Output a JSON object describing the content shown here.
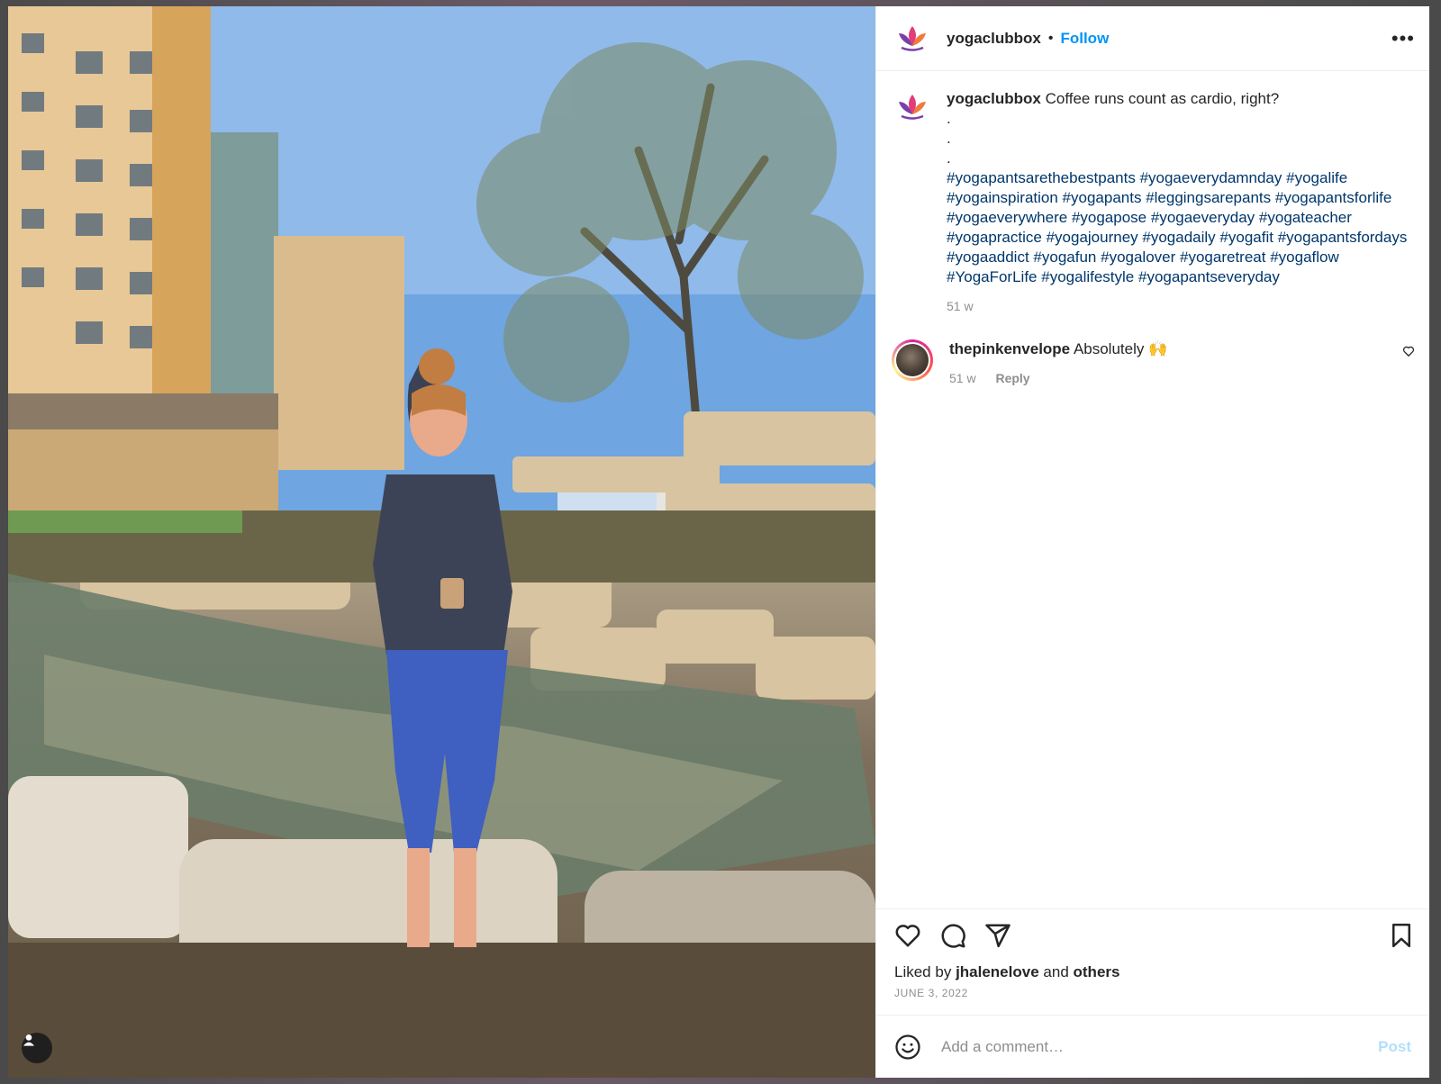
{
  "post": {
    "author": "yogaclubbox",
    "follow_label": "Follow",
    "separator": "•",
    "more_label": "•••",
    "caption": {
      "username": "yogaclubbox",
      "text": "Coffee runs count as cardio, right?\n.\n.\n.",
      "hashtags": [
        "#yogapantsarethebestpants",
        "#yogaeverydamnday",
        "#yogalife",
        "#yogainspiration",
        "#yogapants",
        "#leggingsarepants",
        "#yogapantsforlife",
        "#yogaeverywhere",
        "#yogapose",
        "#yogaeveryday",
        "#yogateacher",
        "#yogapractice",
        "#yogajourney",
        "#yogadaily",
        "#yogafit",
        "#yogapantsfordays",
        "#yogaaddict",
        "#yogafun",
        "#yogalover",
        "#yogaretreat",
        "#yogaflow",
        "#YogaForLife",
        "#yogalifestyle",
        "#yogapantseveryday"
      ],
      "age": "51 w"
    },
    "comments": [
      {
        "username": "thepinkenvelope",
        "text": "Absolutely 🙌",
        "age": "51 w",
        "reply_label": "Reply"
      }
    ],
    "likes": {
      "prefix": "Liked by",
      "user": "jhalenelove",
      "conj": "and",
      "others": "others"
    },
    "date": "JUNE 3, 2022",
    "add_comment": {
      "placeholder": "Add a comment…",
      "post_label": "Post"
    }
  },
  "icons": {
    "avatar": "lotus-logo-icon",
    "like": "heart-icon",
    "comment": "comment-bubble-icon",
    "share": "paper-plane-icon",
    "save": "bookmark-icon",
    "emoji": "smiley-icon",
    "user_tag": "user-icon"
  },
  "colors": {
    "link": "#0095f6",
    "hashtag": "#00376b",
    "muted": "#8e8e8e",
    "post_disabled": "#b2dffc"
  }
}
